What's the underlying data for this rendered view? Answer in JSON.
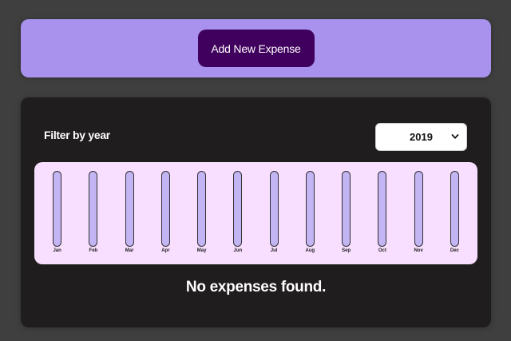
{
  "new_expense": {
    "add_button_label": "Add New Expense"
  },
  "filter": {
    "label": "Filter by year",
    "selected_year": "2019"
  },
  "chart_data": {
    "type": "bar",
    "categories": [
      "Jan",
      "Feb",
      "Mar",
      "Apr",
      "May",
      "Jun",
      "Jul",
      "Aug",
      "Sep",
      "Oct",
      "Nov",
      "Dec"
    ],
    "values": [
      0,
      0,
      0,
      0,
      0,
      0,
      0,
      0,
      0,
      0,
      0,
      0
    ]
  },
  "empty_message": "No expenses found.",
  "colors": {
    "page_bg": "#3f3f3f",
    "panel_accent": "#a892ee",
    "button_bg": "#40005d",
    "expenses_bg": "#1f1d1d",
    "chart_bg": "#f8dfff",
    "bar_empty": "#c3b4f3",
    "bar_fill": "#4826b9"
  }
}
